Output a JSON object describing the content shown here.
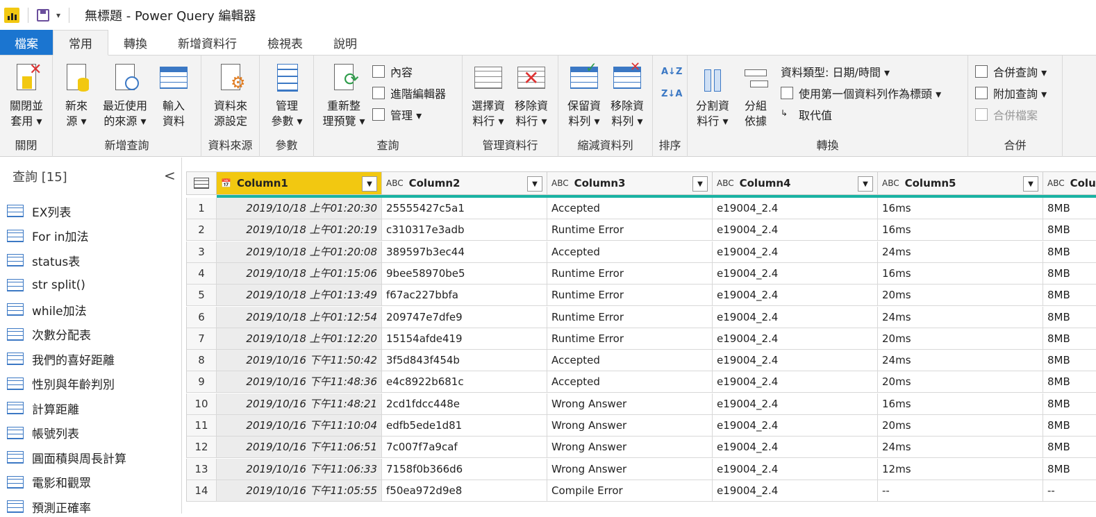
{
  "window": {
    "title": "無標題 - Power Query 編輯器",
    "qat_dropdown": "▾"
  },
  "tabs": [
    "檔案",
    "常用",
    "轉換",
    "新增資料行",
    "檢視表",
    "說明"
  ],
  "ribbon": {
    "close_apply": "關閉並\n套用 ▾",
    "new_source": "新來\n源 ▾",
    "recent_sources": "最近使用\n的來源 ▾",
    "enter_data": "輸入\n資料",
    "data_source_settings": "資料來\n源設定",
    "manage_params": "管理\n參數 ▾",
    "refresh_preview": "重新整\n理預覽 ▾",
    "properties": "內容",
    "advanced_editor": "進階編輯器",
    "manage": "管理 ▾",
    "choose_columns": "選擇資\n料行 ▾",
    "remove_columns": "移除資\n料行 ▾",
    "keep_rows": "保留資\n料列 ▾",
    "remove_rows": "移除資\n料列 ▾",
    "sort_asc": "A↓Z",
    "sort_desc": "Z↓A",
    "split_column": "分割資\n料行 ▾",
    "group_by": "分組\n依據",
    "data_type": "資料類型: 日期/時間 ▾",
    "use_first_row": "使用第一個資料列作為標頭 ▾",
    "replace_values": "取代值",
    "merge_queries": "合併查詢 ▾",
    "append_queries": "附加查詢 ▾",
    "combine_files": "合併檔案",
    "groups": {
      "close": "關閉",
      "new_query": "新增查詢",
      "data_sources": "資料來源",
      "parameters": "參數",
      "query": "查詢",
      "manage_columns": "管理資料行",
      "reduce_rows": "縮減資料列",
      "sort": "排序",
      "transform": "轉換",
      "combine": "合併"
    }
  },
  "queries_pane": {
    "header": "查詢 [15]",
    "collapse": "<",
    "items": [
      "EX列表",
      "For in加法",
      "status表",
      "str split()",
      "while加法",
      "次數分配表",
      "我們的喜好距離",
      "性別與年齡判別",
      "計算距離",
      "帳號列表",
      "圓面積與周長計算",
      "電影和觀眾",
      "預測正確率"
    ]
  },
  "grid": {
    "columns": [
      {
        "name": "Column1",
        "type": "📅"
      },
      {
        "name": "Column2",
        "type": "ABC"
      },
      {
        "name": "Column3",
        "type": "ABC"
      },
      {
        "name": "Column4",
        "type": "ABC"
      },
      {
        "name": "Column5",
        "type": "ABC"
      },
      {
        "name": "Colu",
        "type": "ABC"
      }
    ],
    "rows": [
      [
        "1",
        "2019/10/18 上午01:20:30",
        "25555427c5a1",
        "Accepted",
        "e19004_2.4",
        "16ms",
        "8MB"
      ],
      [
        "2",
        "2019/10/18 上午01:20:19",
        "c310317e3adb",
        "Runtime Error",
        "e19004_2.4",
        "16ms",
        "8MB"
      ],
      [
        "3",
        "2019/10/18 上午01:20:08",
        "389597b3ec44",
        "Accepted",
        "e19004_2.4",
        "24ms",
        "8MB"
      ],
      [
        "4",
        "2019/10/18 上午01:15:06",
        "9bee58970be5",
        "Runtime Error",
        "e19004_2.4",
        "16ms",
        "8MB"
      ],
      [
        "5",
        "2019/10/18 上午01:13:49",
        "f67ac227bbfa",
        "Runtime Error",
        "e19004_2.4",
        "20ms",
        "8MB"
      ],
      [
        "6",
        "2019/10/18 上午01:12:54",
        "209747e7dfe9",
        "Runtime Error",
        "e19004_2.4",
        "24ms",
        "8MB"
      ],
      [
        "7",
        "2019/10/18 上午01:12:20",
        "15154afde419",
        "Runtime Error",
        "e19004_2.4",
        "20ms",
        "8MB"
      ],
      [
        "8",
        "2019/10/16 下午11:50:42",
        "3f5d843f454b",
        "Accepted",
        "e19004_2.4",
        "24ms",
        "8MB"
      ],
      [
        "9",
        "2019/10/16 下午11:48:36",
        "e4c8922b681c",
        "Accepted",
        "e19004_2.4",
        "20ms",
        "8MB"
      ],
      [
        "10",
        "2019/10/16 下午11:48:21",
        "2cd1fdcc448e",
        "Wrong Answer",
        "e19004_2.4",
        "16ms",
        "8MB"
      ],
      [
        "11",
        "2019/10/16 下午11:10:04",
        "edfb5ede1d81",
        "Wrong Answer",
        "e19004_2.4",
        "20ms",
        "8MB"
      ],
      [
        "12",
        "2019/10/16 下午11:06:51",
        "7c007f7a9caf",
        "Wrong Answer",
        "e19004_2.4",
        "24ms",
        "8MB"
      ],
      [
        "13",
        "2019/10/16 下午11:06:33",
        "7158f0b366d6",
        "Wrong Answer",
        "e19004_2.4",
        "12ms",
        "8MB"
      ],
      [
        "14",
        "2019/10/16 下午11:05:55",
        "f50ea972d9e8",
        "Compile Error",
        "e19004_2.4",
        "--",
        "--"
      ]
    ]
  }
}
